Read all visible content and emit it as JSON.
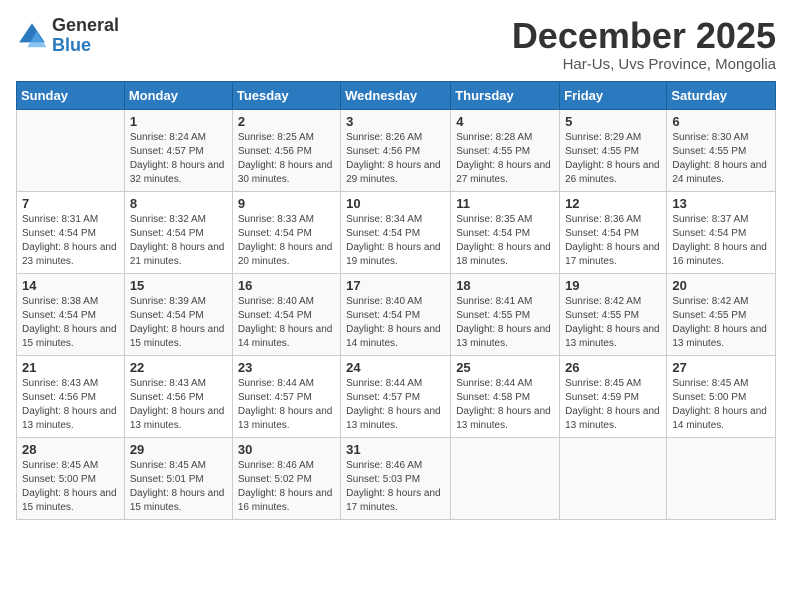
{
  "logo": {
    "general": "General",
    "blue": "Blue"
  },
  "header": {
    "title": "December 2025",
    "subtitle": "Har-Us, Uvs Province, Mongolia"
  },
  "days_of_week": [
    "Sunday",
    "Monday",
    "Tuesday",
    "Wednesday",
    "Thursday",
    "Friday",
    "Saturday"
  ],
  "weeks": [
    [
      {
        "day": "",
        "sunrise": "",
        "sunset": "",
        "daylight": ""
      },
      {
        "day": "1",
        "sunrise": "Sunrise: 8:24 AM",
        "sunset": "Sunset: 4:57 PM",
        "daylight": "Daylight: 8 hours and 32 minutes."
      },
      {
        "day": "2",
        "sunrise": "Sunrise: 8:25 AM",
        "sunset": "Sunset: 4:56 PM",
        "daylight": "Daylight: 8 hours and 30 minutes."
      },
      {
        "day": "3",
        "sunrise": "Sunrise: 8:26 AM",
        "sunset": "Sunset: 4:56 PM",
        "daylight": "Daylight: 8 hours and 29 minutes."
      },
      {
        "day": "4",
        "sunrise": "Sunrise: 8:28 AM",
        "sunset": "Sunset: 4:55 PM",
        "daylight": "Daylight: 8 hours and 27 minutes."
      },
      {
        "day": "5",
        "sunrise": "Sunrise: 8:29 AM",
        "sunset": "Sunset: 4:55 PM",
        "daylight": "Daylight: 8 hours and 26 minutes."
      },
      {
        "day": "6",
        "sunrise": "Sunrise: 8:30 AM",
        "sunset": "Sunset: 4:55 PM",
        "daylight": "Daylight: 8 hours and 24 minutes."
      }
    ],
    [
      {
        "day": "7",
        "sunrise": "Sunrise: 8:31 AM",
        "sunset": "Sunset: 4:54 PM",
        "daylight": "Daylight: 8 hours and 23 minutes."
      },
      {
        "day": "8",
        "sunrise": "Sunrise: 8:32 AM",
        "sunset": "Sunset: 4:54 PM",
        "daylight": "Daylight: 8 hours and 21 minutes."
      },
      {
        "day": "9",
        "sunrise": "Sunrise: 8:33 AM",
        "sunset": "Sunset: 4:54 PM",
        "daylight": "Daylight: 8 hours and 20 minutes."
      },
      {
        "day": "10",
        "sunrise": "Sunrise: 8:34 AM",
        "sunset": "Sunset: 4:54 PM",
        "daylight": "Daylight: 8 hours and 19 minutes."
      },
      {
        "day": "11",
        "sunrise": "Sunrise: 8:35 AM",
        "sunset": "Sunset: 4:54 PM",
        "daylight": "Daylight: 8 hours and 18 minutes."
      },
      {
        "day": "12",
        "sunrise": "Sunrise: 8:36 AM",
        "sunset": "Sunset: 4:54 PM",
        "daylight": "Daylight: 8 hours and 17 minutes."
      },
      {
        "day": "13",
        "sunrise": "Sunrise: 8:37 AM",
        "sunset": "Sunset: 4:54 PM",
        "daylight": "Daylight: 8 hours and 16 minutes."
      }
    ],
    [
      {
        "day": "14",
        "sunrise": "Sunrise: 8:38 AM",
        "sunset": "Sunset: 4:54 PM",
        "daylight": "Daylight: 8 hours and 15 minutes."
      },
      {
        "day": "15",
        "sunrise": "Sunrise: 8:39 AM",
        "sunset": "Sunset: 4:54 PM",
        "daylight": "Daylight: 8 hours and 15 minutes."
      },
      {
        "day": "16",
        "sunrise": "Sunrise: 8:40 AM",
        "sunset": "Sunset: 4:54 PM",
        "daylight": "Daylight: 8 hours and 14 minutes."
      },
      {
        "day": "17",
        "sunrise": "Sunrise: 8:40 AM",
        "sunset": "Sunset: 4:54 PM",
        "daylight": "Daylight: 8 hours and 14 minutes."
      },
      {
        "day": "18",
        "sunrise": "Sunrise: 8:41 AM",
        "sunset": "Sunset: 4:55 PM",
        "daylight": "Daylight: 8 hours and 13 minutes."
      },
      {
        "day": "19",
        "sunrise": "Sunrise: 8:42 AM",
        "sunset": "Sunset: 4:55 PM",
        "daylight": "Daylight: 8 hours and 13 minutes."
      },
      {
        "day": "20",
        "sunrise": "Sunrise: 8:42 AM",
        "sunset": "Sunset: 4:55 PM",
        "daylight": "Daylight: 8 hours and 13 minutes."
      }
    ],
    [
      {
        "day": "21",
        "sunrise": "Sunrise: 8:43 AM",
        "sunset": "Sunset: 4:56 PM",
        "daylight": "Daylight: 8 hours and 13 minutes."
      },
      {
        "day": "22",
        "sunrise": "Sunrise: 8:43 AM",
        "sunset": "Sunset: 4:56 PM",
        "daylight": "Daylight: 8 hours and 13 minutes."
      },
      {
        "day": "23",
        "sunrise": "Sunrise: 8:44 AM",
        "sunset": "Sunset: 4:57 PM",
        "daylight": "Daylight: 8 hours and 13 minutes."
      },
      {
        "day": "24",
        "sunrise": "Sunrise: 8:44 AM",
        "sunset": "Sunset: 4:57 PM",
        "daylight": "Daylight: 8 hours and 13 minutes."
      },
      {
        "day": "25",
        "sunrise": "Sunrise: 8:44 AM",
        "sunset": "Sunset: 4:58 PM",
        "daylight": "Daylight: 8 hours and 13 minutes."
      },
      {
        "day": "26",
        "sunrise": "Sunrise: 8:45 AM",
        "sunset": "Sunset: 4:59 PM",
        "daylight": "Daylight: 8 hours and 13 minutes."
      },
      {
        "day": "27",
        "sunrise": "Sunrise: 8:45 AM",
        "sunset": "Sunset: 5:00 PM",
        "daylight": "Daylight: 8 hours and 14 minutes."
      }
    ],
    [
      {
        "day": "28",
        "sunrise": "Sunrise: 8:45 AM",
        "sunset": "Sunset: 5:00 PM",
        "daylight": "Daylight: 8 hours and 15 minutes."
      },
      {
        "day": "29",
        "sunrise": "Sunrise: 8:45 AM",
        "sunset": "Sunset: 5:01 PM",
        "daylight": "Daylight: 8 hours and 15 minutes."
      },
      {
        "day": "30",
        "sunrise": "Sunrise: 8:46 AM",
        "sunset": "Sunset: 5:02 PM",
        "daylight": "Daylight: 8 hours and 16 minutes."
      },
      {
        "day": "31",
        "sunrise": "Sunrise: 8:46 AM",
        "sunset": "Sunset: 5:03 PM",
        "daylight": "Daylight: 8 hours and 17 minutes."
      },
      {
        "day": "",
        "sunrise": "",
        "sunset": "",
        "daylight": ""
      },
      {
        "day": "",
        "sunrise": "",
        "sunset": "",
        "daylight": ""
      },
      {
        "day": "",
        "sunrise": "",
        "sunset": "",
        "daylight": ""
      }
    ]
  ]
}
